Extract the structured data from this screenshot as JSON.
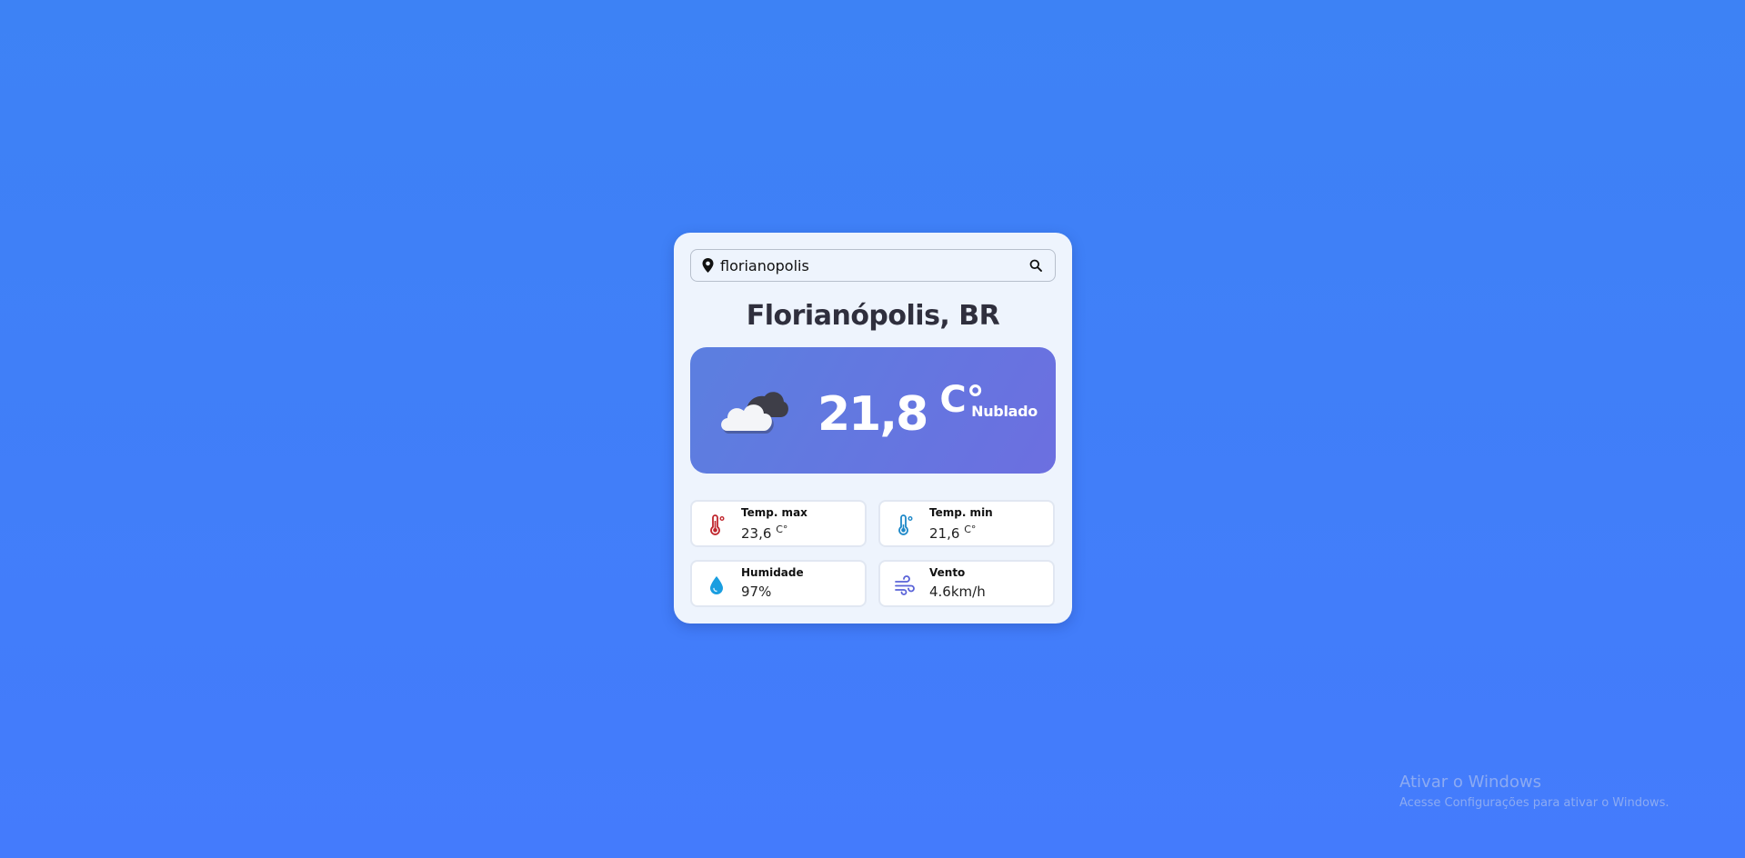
{
  "search": {
    "value": "florianopolis",
    "pin_icon": "location-pin-icon",
    "search_icon": "search-icon"
  },
  "city_name": "Florianópolis, BR",
  "current": {
    "icon": "cloud-icon",
    "temperature": "21,8",
    "unit": "C°",
    "condition": "Nublado"
  },
  "stats": {
    "temp_max": {
      "label": "Temp. max",
      "value": "23,6",
      "unit": "C°",
      "icon": "thermometer-hot-icon"
    },
    "temp_min": {
      "label": "Temp. min",
      "value": "21,6",
      "unit": "C°",
      "icon": "thermometer-cold-icon"
    },
    "humidity": {
      "label": "Humidade",
      "value": "97%",
      "icon": "water-drop-icon"
    },
    "wind": {
      "label": "Vento",
      "value": "4.6km/h",
      "icon": "wind-icon"
    }
  },
  "watermark": {
    "title": "Ativar o Windows",
    "subtitle": "Acesse Configurações para ativar o Windows."
  },
  "colors": {
    "background": "#3d82f5",
    "card": "#eef4fd",
    "hero_start": "#5b7fe0",
    "hero_end": "#6c6fe0",
    "thermometer_hot": "#c0262d",
    "thermometer_cold": "#1e88c8",
    "drop": "#1a9ee0",
    "wind": "#5a63d8"
  }
}
